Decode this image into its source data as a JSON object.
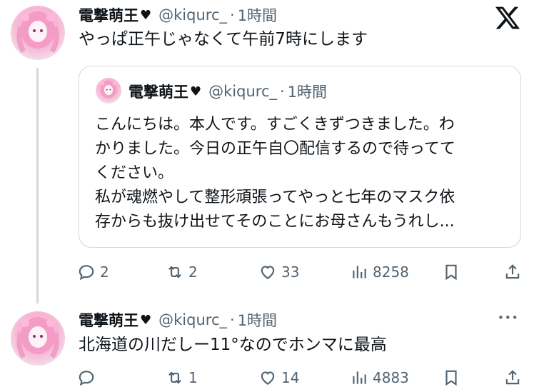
{
  "brand": {
    "logo": "X"
  },
  "tweet1": {
    "author_name": "電撃萌王",
    "heart": "♥",
    "handle": "@kiqurc_",
    "separator": "·",
    "time": "1時間",
    "text": "やっぱ正午じゃなくて午前7時にします",
    "quote": {
      "author_name": "電撃萌王",
      "heart": "♥",
      "handle": "@kiqurc_",
      "separator": "·",
      "time": "1時間",
      "lines": [
        "こんにちは。本人です。すごくきずつきました。わ",
        "かりました。今日の正午自〇配信するので待ってて",
        "ください。",
        "私が魂燃やして整形頑張ってやっと七年のマスク依",
        "存からも抜け出せてそのことにお母さんもうれし..."
      ]
    },
    "actions": {
      "replies": "2",
      "reposts": "2",
      "likes": "33",
      "views": "8258"
    }
  },
  "tweet2": {
    "author_name": "電撃萌王",
    "heart": "♥",
    "handle": "@kiqurc_",
    "separator": "·",
    "time": "1時間",
    "text": "北海道の川だしー11°なのでホンマに最高",
    "more": "•••",
    "actions": {
      "replies": "",
      "reposts": "1",
      "likes": "14",
      "views": "4883"
    }
  },
  "icons": {
    "reply": "reply-icon",
    "repost": "repost-icon",
    "like": "heart-icon",
    "views": "views-icon",
    "bookmark": "bookmark-icon",
    "share": "share-icon",
    "more": "more-icon",
    "logo": "x-logo-icon"
  },
  "colors": {
    "text": "#0f1419",
    "secondary": "#536471",
    "border": "#cfd9de",
    "avatar": "#f7b3d3"
  }
}
